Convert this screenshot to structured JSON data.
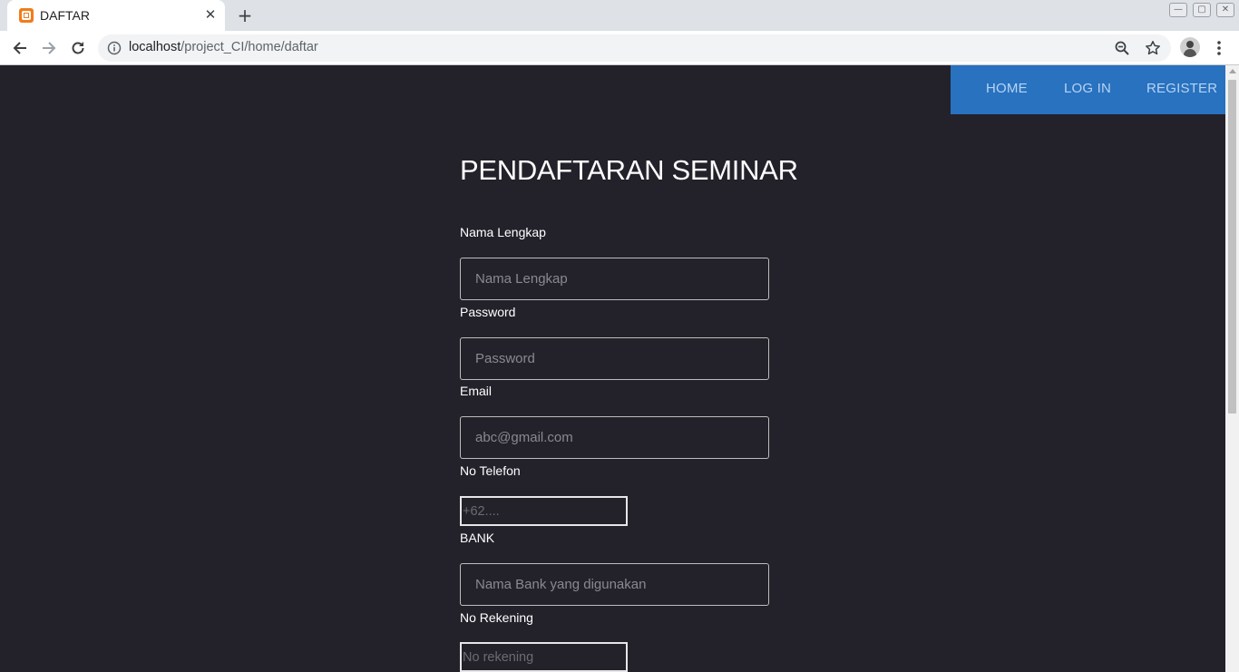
{
  "browser": {
    "tab_title": "DAFTAR",
    "tab_close_glyph": "✕",
    "new_tab_glyph": "+",
    "url_host": "localhost",
    "url_path": "/project_CI/home/daftar",
    "icons": [
      "back-arrow-icon",
      "forward-arrow-icon",
      "reload-icon",
      "site-info-icon",
      "zoom-icon",
      "bookmark-star-icon",
      "profile-avatar-icon",
      "menu-dots-icon"
    ]
  },
  "nav": {
    "links": [
      {
        "label": "HOME"
      },
      {
        "label": "LOG IN"
      },
      {
        "label": "REGISTER"
      }
    ],
    "background": "#2872c0"
  },
  "form": {
    "title": "PENDAFTARAN SEMINAR",
    "fields": [
      {
        "label": "Nama Lengkap",
        "placeholder": "Nama Lengkap"
      },
      {
        "label": "Password",
        "placeholder": "Password"
      },
      {
        "label": "Email",
        "placeholder": "abc@gmail.com"
      },
      {
        "label": "No Telefon",
        "placeholder": "+62...."
      },
      {
        "label": "BANK",
        "placeholder": "Nama Bank yang digunakan"
      },
      {
        "label": "No Rekening",
        "placeholder": "No rekening"
      }
    ]
  },
  "colors": {
    "page_background": "#23212a",
    "accent": "#2872c0"
  }
}
